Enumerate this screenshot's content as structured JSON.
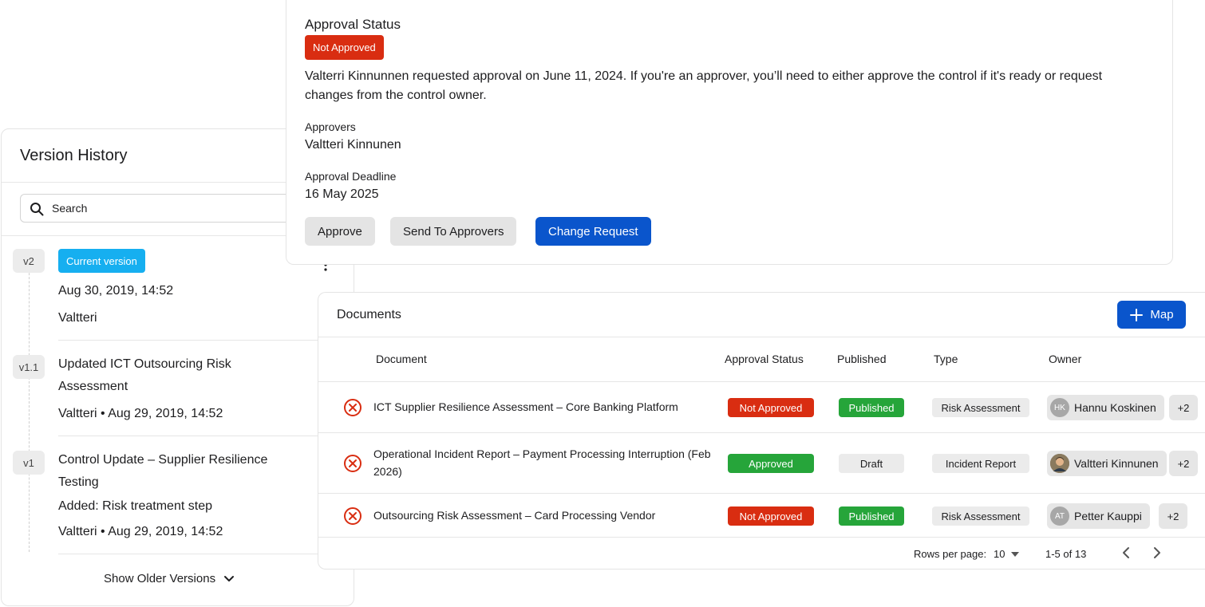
{
  "version_history": {
    "title": "Version History",
    "search_placeholder": "Search",
    "current_badge": "Current version",
    "versions": [
      {
        "tag": "v2",
        "line1": "Aug 30, 2019, 14:52",
        "line2": "Valtteri"
      },
      {
        "tag": "v1.1",
        "title": "Updated ICT Outsourcing Risk Assessment",
        "meta": "Valtteri • Aug 29, 2019, 14:52"
      },
      {
        "tag": "v1",
        "title": "Control Update – Supplier Resilience Testing",
        "note": "Added: Risk treatment step",
        "meta": "Valtteri • Aug 29, 2019, 14:52"
      }
    ],
    "show_older": "Show Older Versions"
  },
  "approval": {
    "title": "Approval Status",
    "status_badge": "Not Approved",
    "description": "Valterri Kinnunnen requested approval on June 11, 2024. If you're an approver, you’ll need to either approve the control if it's ready or request changes from the control owner.",
    "approvers_label": "Approvers",
    "approvers_value": "Valtteri Kinnunen",
    "deadline_label": "Approval Deadline",
    "deadline_value": "16 May 2025",
    "buttons": {
      "approve": "Approve",
      "send": "Send To Approvers",
      "change": "Change Request"
    }
  },
  "documents": {
    "title": "Documents",
    "map_button": "Map",
    "columns": {
      "document": "Document",
      "approval": "Approval Status",
      "published": "Published",
      "type": "Type",
      "owner": "Owner"
    },
    "rows": [
      {
        "name": "ICT Supplier Resilience Assessment – Core Banking Platform",
        "approval": "Not Approved",
        "published": "Published",
        "type": "Risk Assessment",
        "owner_initials": "HK",
        "owner": "Hannu Koskinen",
        "extra": "+2"
      },
      {
        "name": "Operational Incident Report – Payment Processing Interruption (Feb 2026)",
        "approval": "Approved",
        "published": "Draft",
        "type": "Incident Report",
        "owner_initials": "",
        "owner": "Valtteri Kinnunen",
        "extra": "+2"
      },
      {
        "name": "Outsourcing Risk Assessment – Card Processing Vendor",
        "approval": "Not Approved",
        "published": "Published",
        "type": "Risk Assessment",
        "owner_initials": "AT",
        "owner": "Petter Kauppi",
        "extra": "+2"
      }
    ],
    "footer": {
      "rows_per_page_label": "Rows per page:",
      "rows_per_page_value": "10",
      "range": "1-5 of 13"
    }
  },
  "colors": {
    "accent_blue": "#0a55cc",
    "cyan": "#16aff0",
    "red": "#d92d11",
    "green": "#26a53a"
  },
  "icons": [
    "search-icon",
    "chevron-down-icon",
    "kebab-icon",
    "plus-icon",
    "x-circle-icon",
    "caret-down-icon",
    "chevron-left-icon",
    "chevron-right-icon"
  ]
}
